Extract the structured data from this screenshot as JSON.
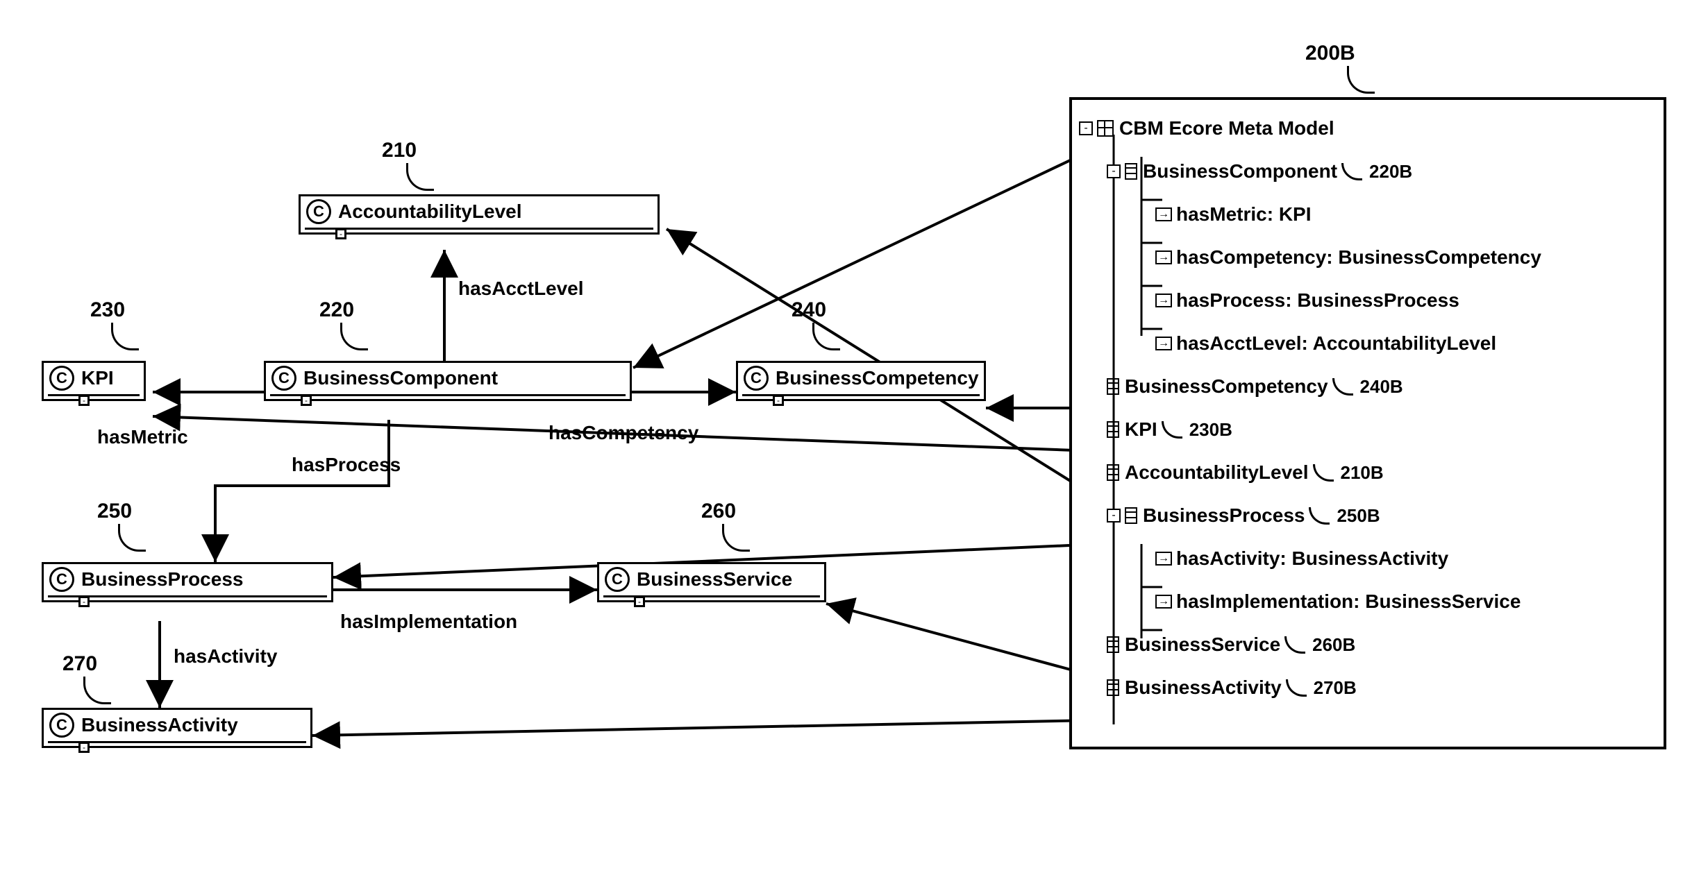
{
  "classes": {
    "accountabilityLevel": {
      "name": "AccountabilityLevel",
      "ref": "210"
    },
    "kpi": {
      "name": "KPI",
      "ref": "230"
    },
    "businessComponent": {
      "name": "BusinessComponent",
      "ref": "220"
    },
    "businessCompetency": {
      "name": "BusinessCompetency",
      "ref": "240"
    },
    "businessProcess": {
      "name": "BusinessProcess",
      "ref": "250"
    },
    "businessService": {
      "name": "BusinessService",
      "ref": "260"
    },
    "businessActivity": {
      "name": "BusinessActivity",
      "ref": "270"
    }
  },
  "edges": {
    "hasAcctLevel": "hasAcctLevel",
    "hasMetric": "hasMetric",
    "hasCompetency": "hasCompetency",
    "hasProcess": "hasProcess",
    "hasImplementation": "hasImplementation",
    "hasActivity": "hasActivity"
  },
  "tree": {
    "title": "CBM Ecore Meta Model",
    "panelRef": "200B",
    "nodes": {
      "businessComponent": {
        "label": "BusinessComponent",
        "ref": "220B"
      },
      "bc_hasMetric": {
        "label": "hasMetric: KPI"
      },
      "bc_hasCompetency": {
        "label": "hasCompetency: BusinessCompetency"
      },
      "bc_hasProcess": {
        "label": "hasProcess: BusinessProcess"
      },
      "bc_hasAcctLevel": {
        "label": "hasAcctLevel: AccountabilityLevel"
      },
      "businessCompetency": {
        "label": "BusinessCompetency",
        "ref": "240B"
      },
      "kpi": {
        "label": "KPI",
        "ref": "230B"
      },
      "accountabilityLevel": {
        "label": "AccountabilityLevel",
        "ref": "210B"
      },
      "businessProcess": {
        "label": "BusinessProcess",
        "ref": "250B"
      },
      "bp_hasActivity": {
        "label": "hasActivity: BusinessActivity"
      },
      "bp_hasImplementation": {
        "label": "hasImplementation: BusinessService"
      },
      "businessService": {
        "label": "BusinessService",
        "ref": "260B"
      },
      "businessActivity": {
        "label": "BusinessActivity",
        "ref": "270B"
      }
    }
  },
  "chart_data": {
    "type": "diagram",
    "title": "CBM Ecore Meta Model",
    "classes": [
      {
        "id": 210,
        "name": "AccountabilityLevel"
      },
      {
        "id": 220,
        "name": "BusinessComponent"
      },
      {
        "id": 230,
        "name": "KPI"
      },
      {
        "id": 240,
        "name": "BusinessCompetency"
      },
      {
        "id": 250,
        "name": "BusinessProcess"
      },
      {
        "id": 260,
        "name": "BusinessService"
      },
      {
        "id": 270,
        "name": "BusinessActivity"
      }
    ],
    "relationships": [
      {
        "from": "BusinessComponent",
        "to": "AccountabilityLevel",
        "label": "hasAcctLevel"
      },
      {
        "from": "BusinessComponent",
        "to": "KPI",
        "label": "hasMetric"
      },
      {
        "from": "BusinessComponent",
        "to": "BusinessCompetency",
        "label": "hasCompetency"
      },
      {
        "from": "BusinessComponent",
        "to": "BusinessProcess",
        "label": "hasProcess"
      },
      {
        "from": "BusinessProcess",
        "to": "BusinessService",
        "label": "hasImplementation"
      },
      {
        "from": "BusinessProcess",
        "to": "BusinessActivity",
        "label": "hasActivity"
      }
    ],
    "treeMappings": [
      {
        "class": "BusinessComponent",
        "treeRef": "220B"
      },
      {
        "class": "BusinessCompetency",
        "treeRef": "240B"
      },
      {
        "class": "KPI",
        "treeRef": "230B"
      },
      {
        "class": "AccountabilityLevel",
        "treeRef": "210B"
      },
      {
        "class": "BusinessProcess",
        "treeRef": "250B"
      },
      {
        "class": "BusinessService",
        "treeRef": "260B"
      },
      {
        "class": "BusinessActivity",
        "treeRef": "270B"
      }
    ]
  }
}
